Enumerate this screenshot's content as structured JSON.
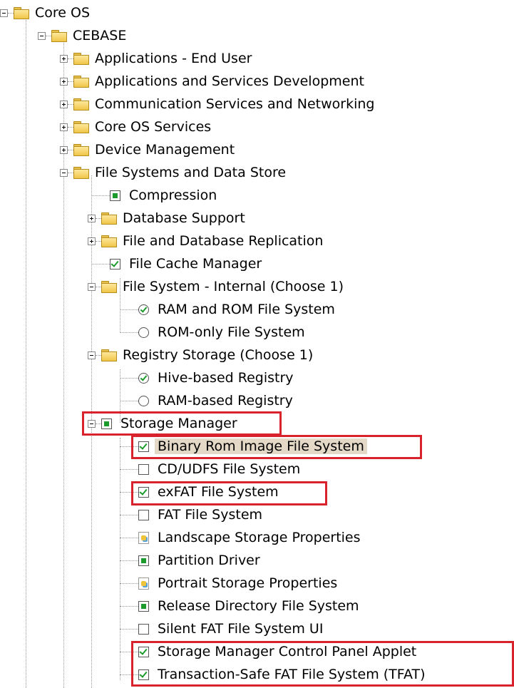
{
  "tree": {
    "root": {
      "label": "Core OS"
    },
    "cebase": {
      "label": "CEBASE"
    },
    "items": {
      "applications_end_user": "Applications - End User",
      "apps_services_dev": "Applications and Services Development",
      "comm_services": "Communication Services and Networking",
      "core_os_services": "Core OS Services",
      "device_management": "Device Management",
      "file_systems": "File Systems and Data Store",
      "compression": "Compression",
      "database_support": "Database Support",
      "file_db_replication": "File and Database Replication",
      "file_cache_manager": "File Cache Manager",
      "fs_internal": "File System - Internal (Choose 1)",
      "ram_rom_fs": "RAM and ROM File System",
      "rom_only_fs": "ROM-only File System",
      "registry_storage": "Registry Storage (Choose 1)",
      "hive_registry": "Hive-based Registry",
      "ram_registry": "RAM-based Registry",
      "storage_manager": "Storage Manager",
      "binary_rom": "Binary Rom Image File System",
      "cd_udfs": "CD/UDFS File System",
      "exfat": "exFAT File System",
      "fat": "FAT File System",
      "landscape_props": "Landscape Storage Properties",
      "partition_driver": "Partition Driver",
      "portrait_props": "Portrait Storage Properties",
      "release_dir_fs": "Release Directory File System",
      "silent_fat_ui": "Silent FAT File System UI",
      "sm_cpl": "Storage Manager Control Panel Applet",
      "tfat": "Transaction-Safe FAT File System (TFAT)"
    }
  },
  "colors": {
    "highlight_box": "#d8222c",
    "check_green": "#1a9b2b",
    "selection_bg": "#e4d8c6"
  }
}
